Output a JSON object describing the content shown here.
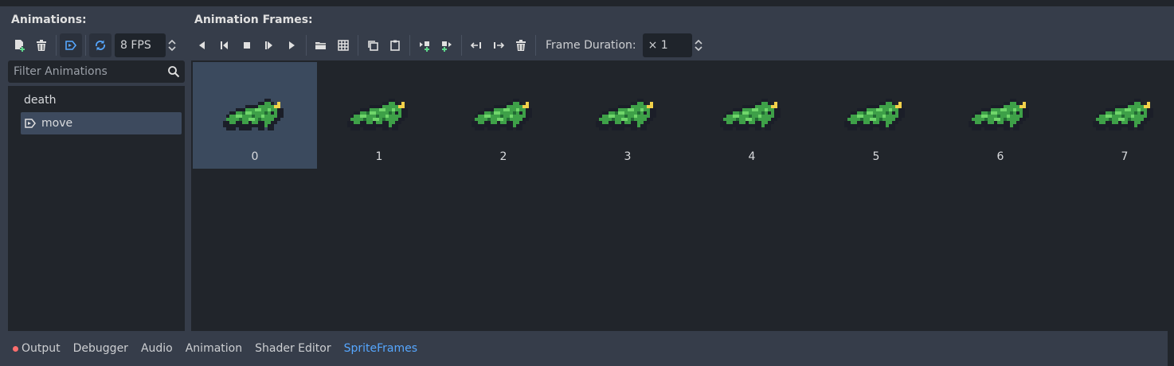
{
  "headers": {
    "animations": "Animations:",
    "frames": "Animation Frames:"
  },
  "toolbar": {
    "fps": "8 FPS",
    "frame_duration_label": "Frame Duration:",
    "frame_duration_value": "× 1",
    "accent": "#56a7ff"
  },
  "filter": {
    "placeholder": "Filter Animations"
  },
  "animations": [
    "death",
    "move"
  ],
  "selected_animation": "move",
  "frames": [
    "0",
    "1",
    "2",
    "3",
    "4",
    "5",
    "6",
    "7"
  ],
  "selected_frame": "0",
  "bottom_tabs": [
    "Output",
    "Debugger",
    "Audio",
    "Animation",
    "Shader Editor",
    "SpriteFrames"
  ],
  "active_tab": "SpriteFrames"
}
